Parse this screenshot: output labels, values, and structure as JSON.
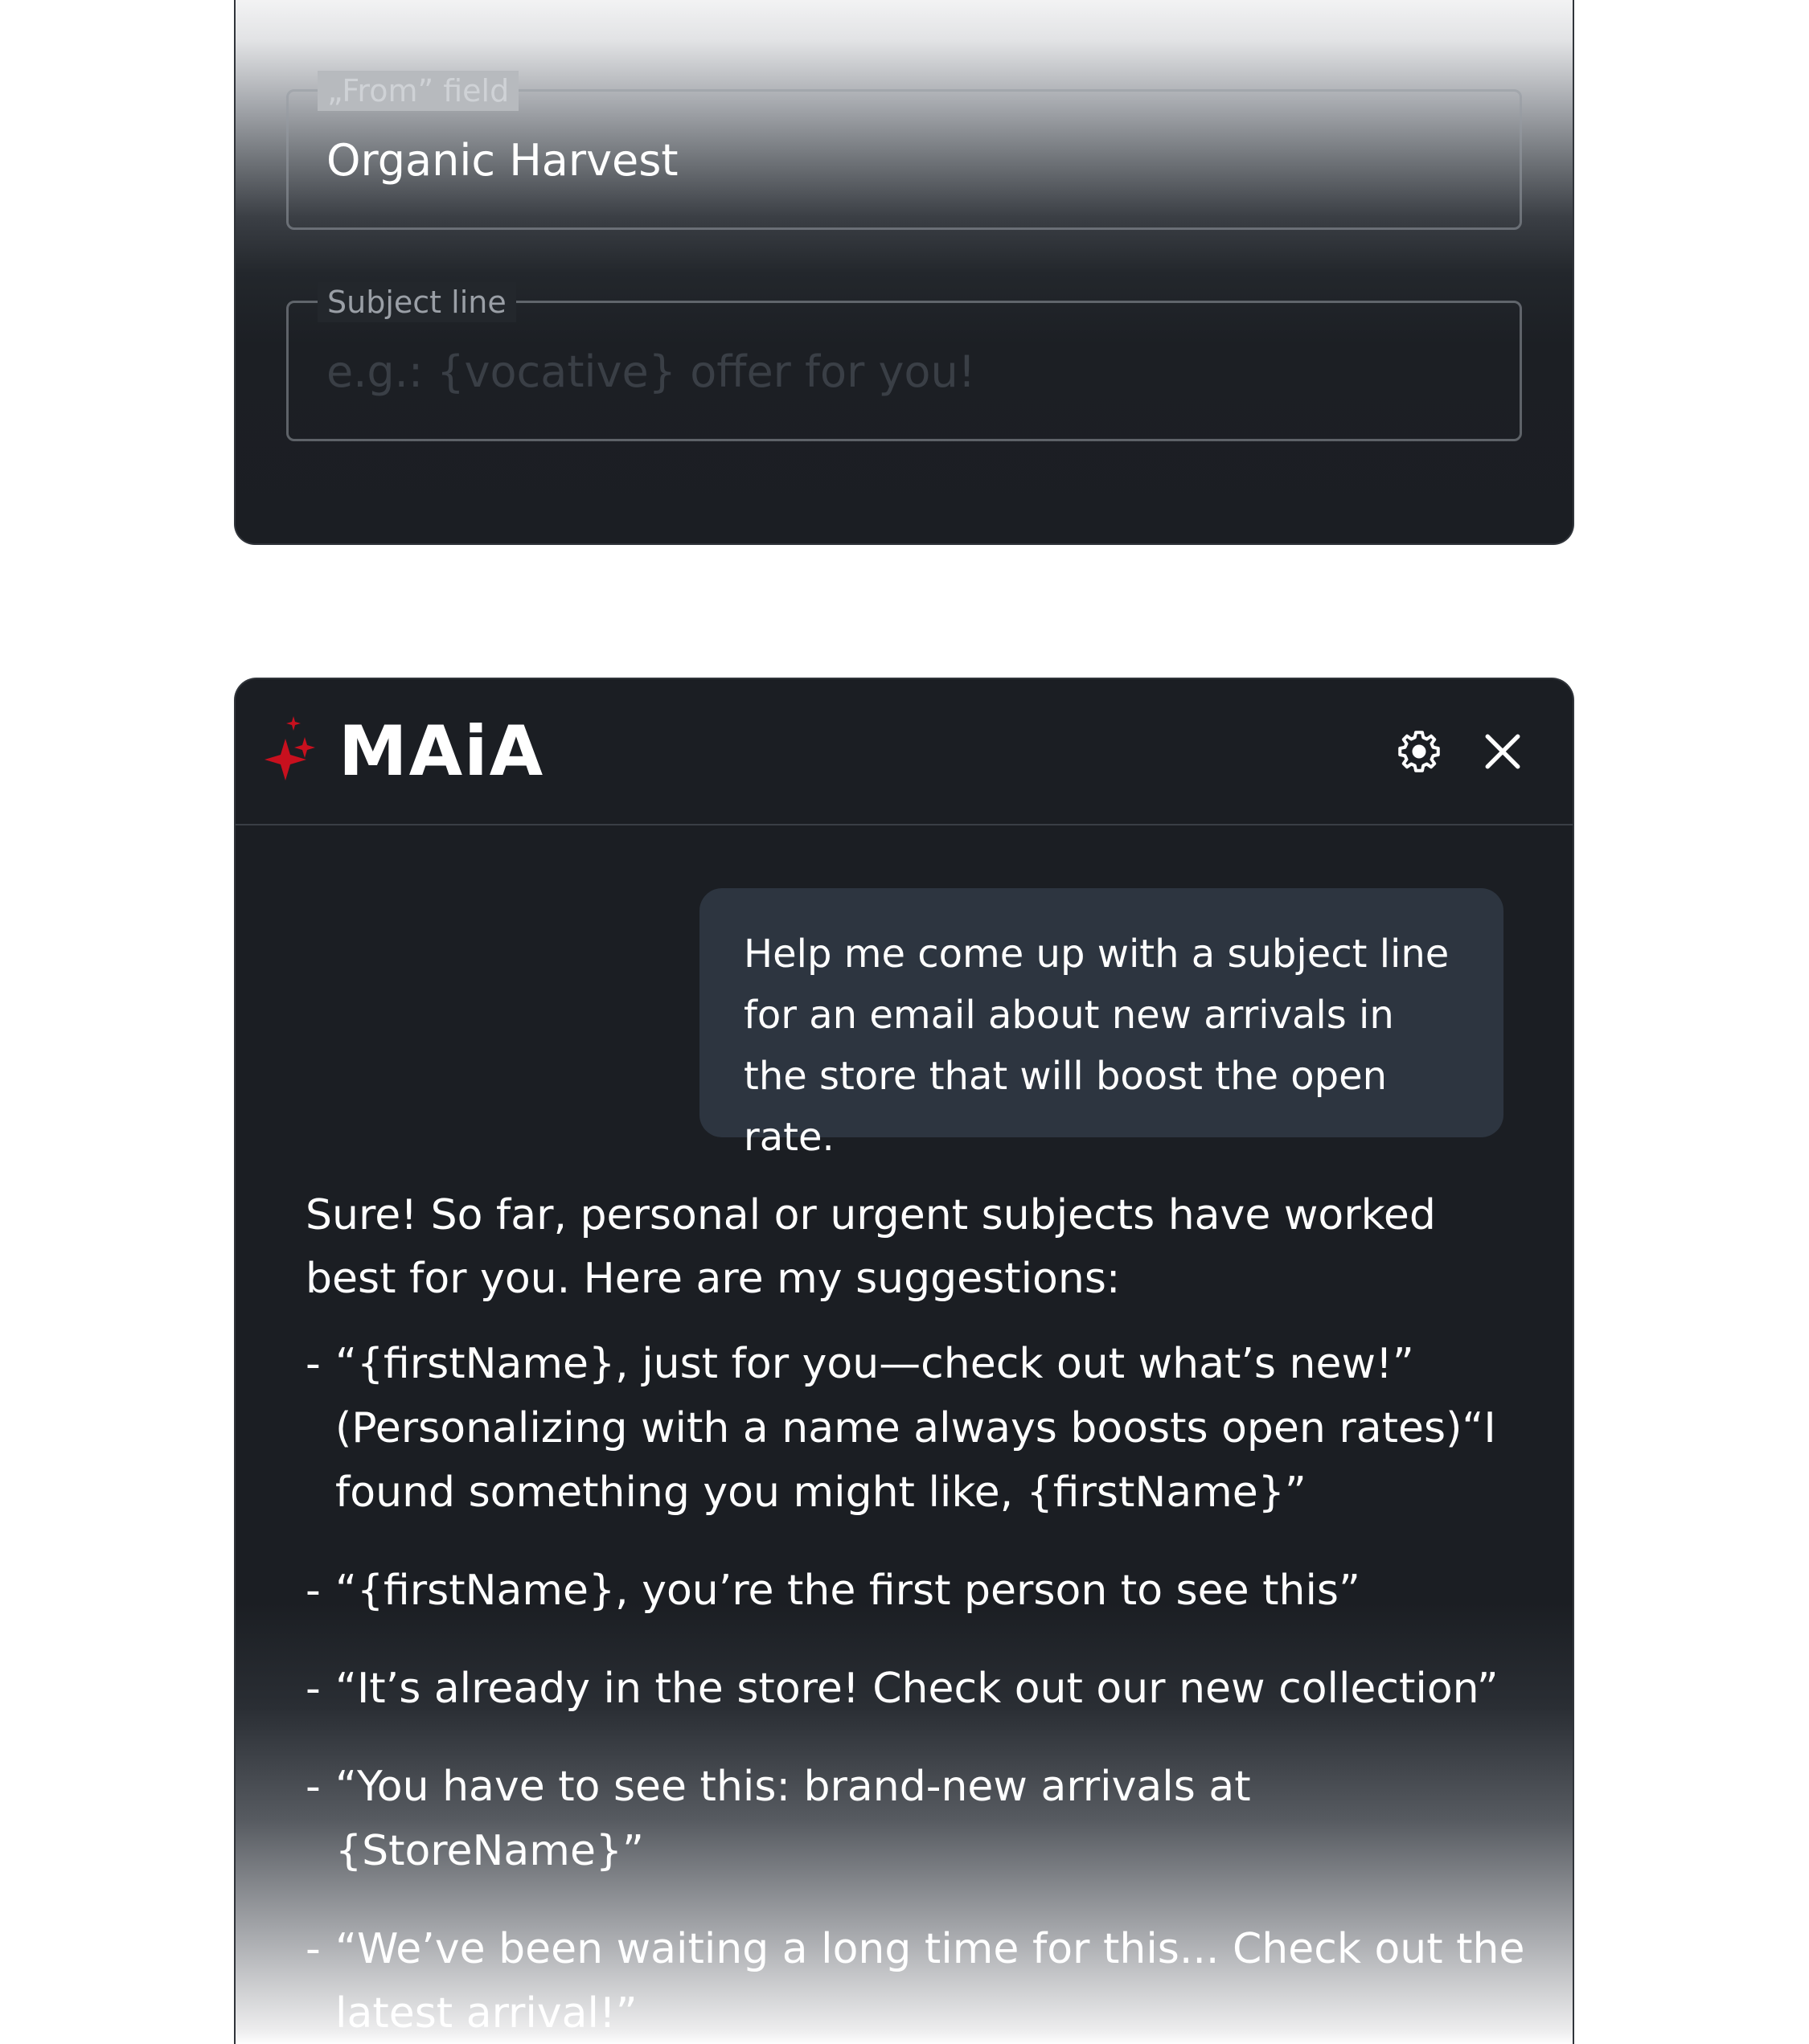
{
  "form": {
    "from_field": {
      "label": "„From” field",
      "value": "Organic Harvest"
    },
    "subject_field": {
      "label": "Subject line",
      "value": "",
      "placeholder": "e.g.: {vocative} offer for you!"
    }
  },
  "chat": {
    "brand": "MAiA",
    "icons": {
      "logo": "sparkle-icon",
      "settings": "gear-icon",
      "close": "close-icon"
    },
    "colors": {
      "brand_accent": "#c8101e",
      "panel_bg": "#1b1e23",
      "user_bubble": "#2d3540"
    },
    "user_message": "Help me come up with a subject line for an email about new arrivals in the store that will boost the open rate.",
    "assistant_intro": "Sure! So far, personal or urgent subjects have worked best for you. Here are my suggestions:",
    "suggestions": [
      "“{firstName}, just for you—check out what’s new!” (Personalizing with a name always boosts open rates)“I found something you might like, {firstName}”",
      "“{firstName}, you’re the first person to see this”",
      "“It’s already in the store! Check out our new collection”",
      "“You have to see this: brand-new arrivals at {StoreName}”",
      "“We’ve been waiting a long time for this... Check out the latest arrival!”"
    ]
  }
}
